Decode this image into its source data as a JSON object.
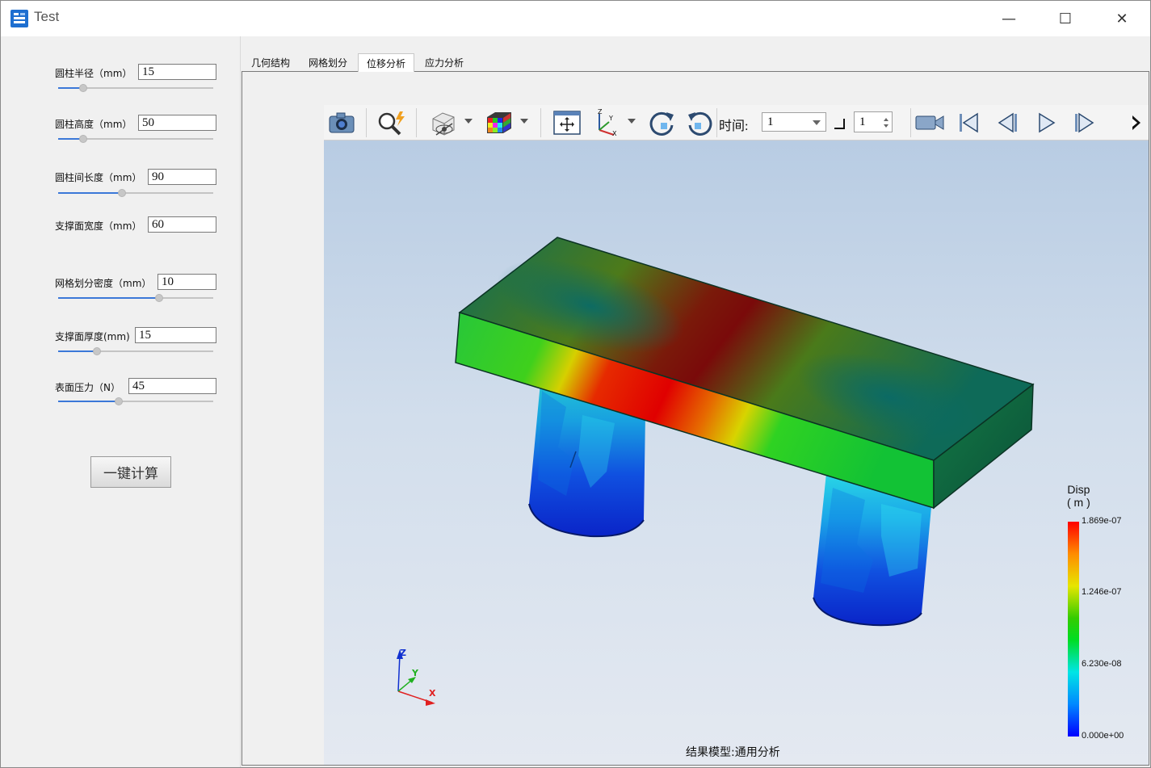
{
  "window": {
    "title": "Test",
    "minimize": "—",
    "maximize": "☐",
    "close": "✕"
  },
  "params": [
    {
      "label": "圆柱半径（mm）",
      "value": "15",
      "slider": 0.16
    },
    {
      "label": "圆柱高度（mm）",
      "value": "50",
      "slider": 0.16
    },
    {
      "label": "圆柱间长度（mm）",
      "value": "90",
      "slider": 0.41
    },
    {
      "label": "支撑面宽度（mm）",
      "value": "60"
    },
    {
      "label": "网格划分密度（mm）",
      "value": "10",
      "slider": 0.65
    },
    {
      "label": "支撑面厚度(mm)",
      "value": "15",
      "slider": 0.25
    },
    {
      "label": "表面压力（N）",
      "value": "45",
      "slider": 0.39
    }
  ],
  "calc_button": "一键计算",
  "tabs": [
    "几何结构",
    "网格划分",
    "位移分析",
    "应力分析"
  ],
  "active_tab": 2,
  "toolbar": {
    "time_label": "时间:",
    "time_value": "1",
    "step_value": "1"
  },
  "legend": {
    "title_line1": "Disp",
    "title_line2": "( m )",
    "max": "1.869e-07",
    "v2": "1.246e-07",
    "v3": "6.230e-08",
    "min": "0.000e+00"
  },
  "axes": {
    "x": "X",
    "y": "Y",
    "z": "Z"
  },
  "result_model": "结果模型:通用分析",
  "colors": {
    "accent": "#3b78d8",
    "max": "#ff0000",
    "min": "#0000ff"
  }
}
